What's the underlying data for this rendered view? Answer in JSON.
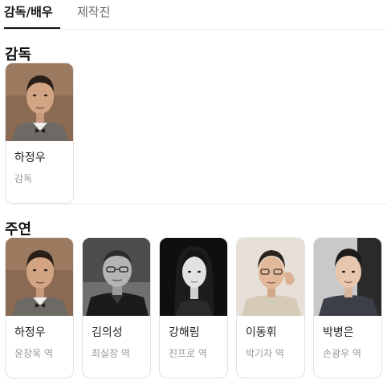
{
  "tabs": [
    {
      "label": "감독/배우",
      "active": true
    },
    {
      "label": "제작진",
      "active": false
    }
  ],
  "directors": {
    "title": "감독",
    "people": [
      {
        "name": "하정우",
        "role": "감독",
        "photo": "portrait-warm-brown"
      }
    ]
  },
  "leads": {
    "title": "주연",
    "people": [
      {
        "name": "하정우",
        "role": "윤창욱 역",
        "photo": "portrait-warm-brown"
      },
      {
        "name": "김의성",
        "role": "최실장 역",
        "photo": "portrait-bw-glasses"
      },
      {
        "name": "강해림",
        "role": "진프로 역",
        "photo": "portrait-bw-woman"
      },
      {
        "name": "이동휘",
        "role": "박기자 역",
        "photo": "portrait-beige-thinking"
      },
      {
        "name": "박병은",
        "role": "손광우 역",
        "photo": "portrait-gray-dark"
      }
    ]
  },
  "colors": {
    "accent": "#111111",
    "muted_text": "#999999",
    "border": "#e3e3e3"
  }
}
